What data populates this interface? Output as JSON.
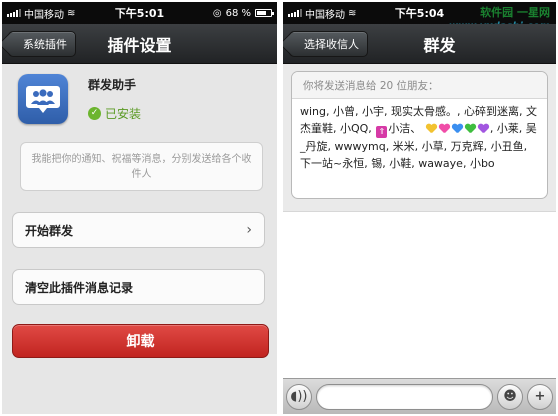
{
  "left": {
    "status": {
      "carrier": "中国移动",
      "time": "下午5:01",
      "battery": "68 %",
      "battery_level": 0.68
    },
    "nav": {
      "back_label": "系统插件",
      "title": "插件设置"
    },
    "plugin": {
      "name": "群发助手",
      "status": "已安装",
      "description": "我能把你的通知、祝福等消息，分别发送给各个收件人",
      "icon": "people-group-icon"
    },
    "actions": {
      "start_label": "开始群发",
      "clear_label": "清空此插件消息记录",
      "uninstall_label": "卸载"
    }
  },
  "right": {
    "status": {
      "carrier": "中国移动",
      "time": "下午5:04"
    },
    "nav": {
      "back_label": "选择收信人",
      "title": "群发"
    },
    "watermark": {
      "text": "软件园 一星网",
      "url": "www.yxdashi.com"
    },
    "recipients_hint": "你将发送消息给 20 位朋友：",
    "recipients_text": {
      "line1": "wing, 小曾, 小宇, 现实太骨感。, 心碎到迷离, 文杰童鞋, 小QQ,",
      "line2": "小洁、",
      "line3": ", 小莱, 吴_丹旋, wwwymq, 米米, 小草, 万克辉, 小丑鱼, 下一站~永恒, 锡, 小鞋, wawaye, 小bo"
    },
    "heart_colors": [
      "#f2c230",
      "#f04da8",
      "#3b8ff0",
      "#3fbe3f",
      "#a256e0"
    ]
  },
  "colors": {
    "installed_green": "#5a9a23",
    "uninstall_red": "#d2332f",
    "nav_dark": "#2b2e30"
  }
}
